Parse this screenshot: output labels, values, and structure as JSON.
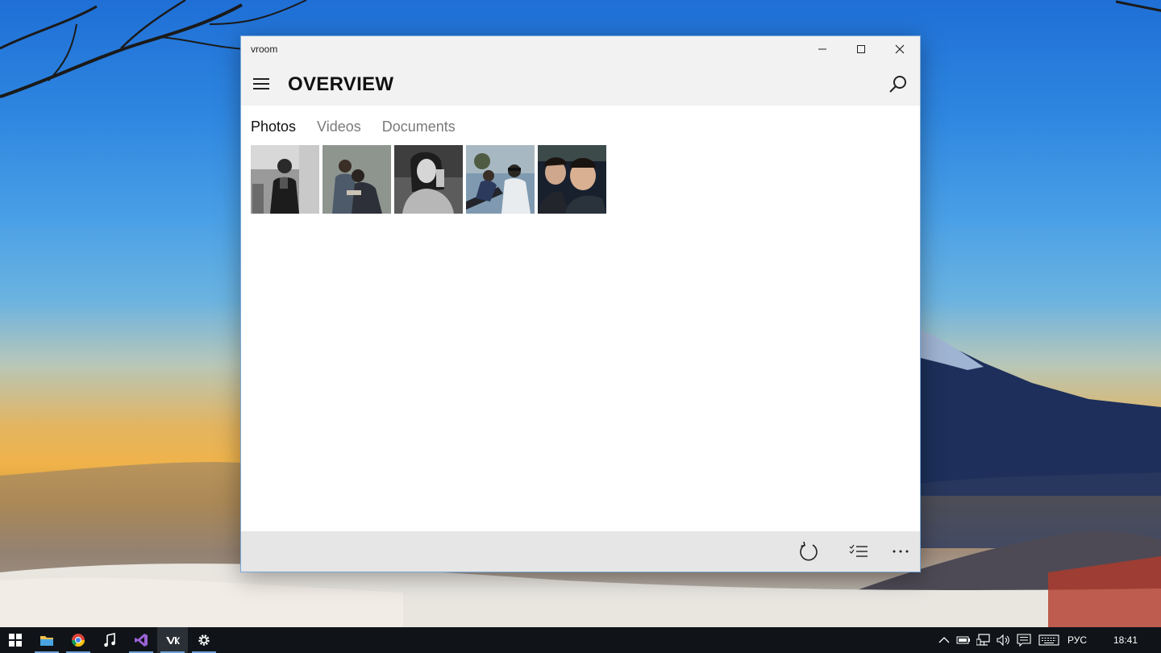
{
  "window": {
    "title": "vroom",
    "header": {
      "page_title": "OVERVIEW"
    },
    "tabs": [
      {
        "label": "Photos",
        "active": true
      },
      {
        "label": "Videos",
        "active": false
      },
      {
        "label": "Documents",
        "active": false
      }
    ],
    "photos_count": 5,
    "appbar": {
      "buttons": [
        "refresh-icon",
        "select-list-icon",
        "more-icon"
      ]
    }
  },
  "taskbar": {
    "apps": [
      "start",
      "file-explorer",
      "chrome",
      "music",
      "visual-studio",
      "vroom",
      "settings"
    ],
    "language": "РУС",
    "time": "18:41"
  }
}
